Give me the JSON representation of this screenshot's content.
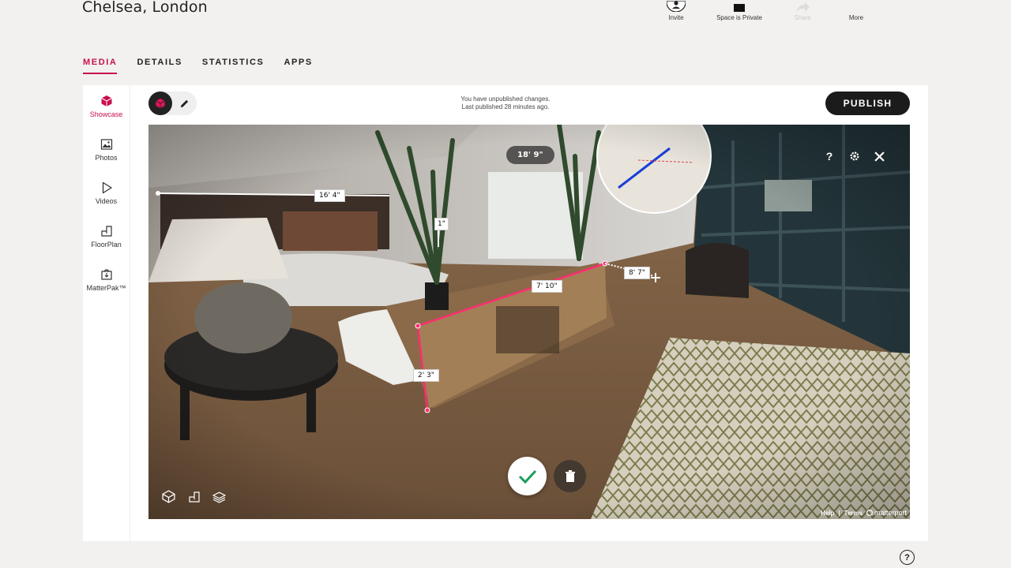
{
  "header": {
    "title": "Chelsea, London",
    "actions": [
      {
        "label": "Invite",
        "icon": "person-icon"
      },
      {
        "label": "Space is Private",
        "icon": "lock-icon"
      },
      {
        "label": "Share",
        "icon": "share-icon"
      },
      {
        "label": "More",
        "icon": "more-icon"
      }
    ]
  },
  "tabs": [
    "MEDIA",
    "DETAILS",
    "STATISTICS",
    "APPS"
  ],
  "sidebar": {
    "items": [
      {
        "label": "Showcase",
        "icon": "cube-icon"
      },
      {
        "label": "Photos",
        "icon": "image-icon"
      },
      {
        "label": "Videos",
        "icon": "play-icon"
      },
      {
        "label": "FloorPlan",
        "icon": "floorplan-icon"
      },
      {
        "label": "MatterPak™",
        "icon": "package-icon"
      }
    ]
  },
  "toolbar": {
    "status_line1": "You have unpublished changes.",
    "status_line2": "Last published 28 minutes ago.",
    "publish_label": "PUBLISH"
  },
  "viewer": {
    "measurements": {
      "top_pill": "18' 9\"",
      "wall": "16' 4\"",
      "plant": "1\"",
      "cabinet_length": "7' 10\"",
      "cabinet_height": "2' 3\"",
      "floor_line": "8' 7\""
    },
    "controls": {
      "help": "?"
    },
    "footer": {
      "help": "Help",
      "sep": "|",
      "terms": "Terms",
      "brand": "matterport"
    }
  },
  "help_fab": "?",
  "colors": {
    "accent": "#c8104e",
    "measure_line": "#ff2d6f",
    "confirm": "#1a9d5a"
  }
}
